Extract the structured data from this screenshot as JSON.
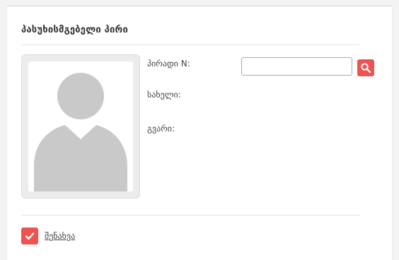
{
  "panel": {
    "title": "პასუხისმგებელი პირი"
  },
  "form": {
    "id_label": "პირადი N:",
    "name_label": "სახელი:",
    "surname_label": "გვარი:",
    "id_value": "",
    "id_placeholder": ""
  },
  "actions": {
    "save_label": "შენახვა"
  },
  "colors": {
    "accent": "#ef5350",
    "avatar_gray": "#c9c9c9"
  },
  "icons": {
    "search": "search-icon",
    "check": "check-icon",
    "avatar": "avatar-placeholder"
  }
}
